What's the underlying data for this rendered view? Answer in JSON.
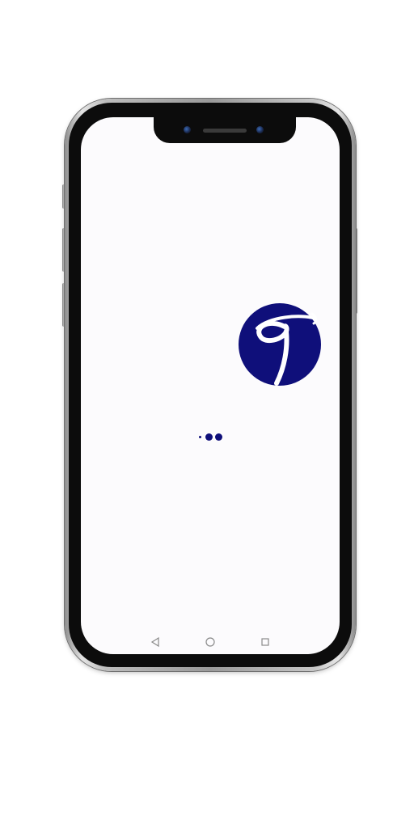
{
  "device": {
    "type": "smartphone"
  },
  "splash": {
    "logo_icon": "brand-logo-icon",
    "brand_color": "#0f0f7a",
    "background_color": "#fcfbfd",
    "loading_indicator": "loading-dots"
  },
  "nav_bar": {
    "items": [
      {
        "icon": "back-triangle-icon"
      },
      {
        "icon": "home-circle-icon"
      },
      {
        "icon": "recents-square-icon"
      }
    ]
  }
}
